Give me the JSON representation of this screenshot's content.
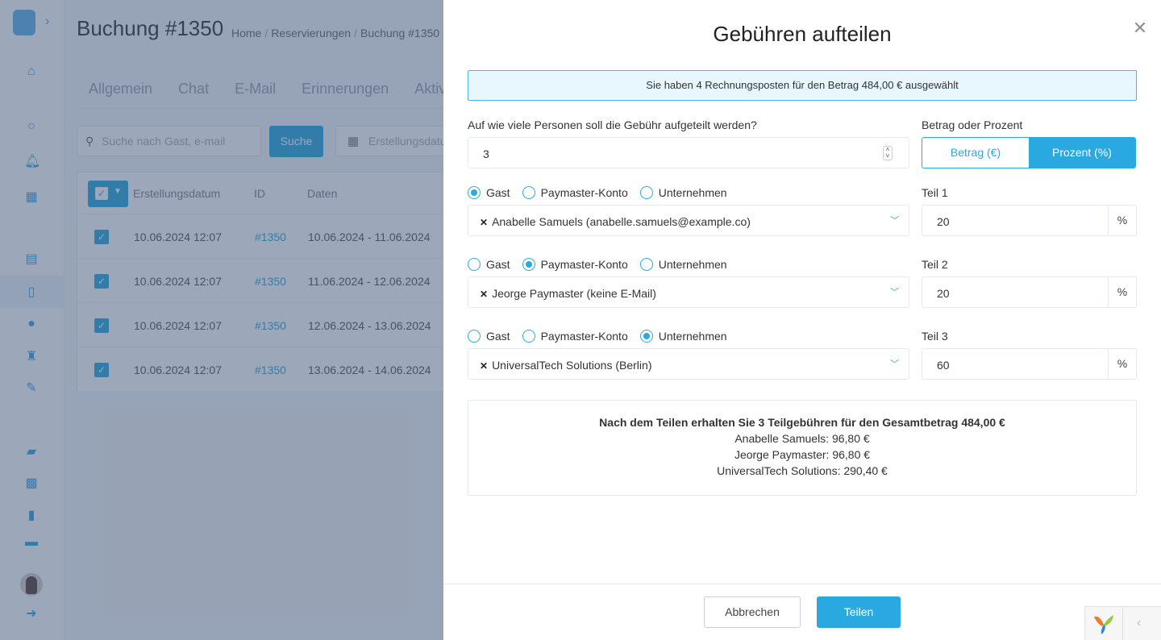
{
  "app": {
    "page_title": "Buchung #1350",
    "breadcrumb": [
      "Home",
      "Reservierungen",
      "Buchung #1350"
    ],
    "tabs": [
      "Allgemein",
      "Chat",
      "E-Mail",
      "Erinnerungen",
      "Aktiv"
    ],
    "search": {
      "placeholder": "Suche nach Gast, e-mail",
      "button": "Suche"
    },
    "date_filter": {
      "placeholder": "Erstellungsdatum"
    },
    "table": {
      "columns": [
        "Erstellungsdatum",
        "ID",
        "Daten"
      ],
      "rows": [
        {
          "created": "10.06.2024 12:07",
          "id": "#1350",
          "dates": "10.06.2024 - 11.06.2024",
          "checked": true
        },
        {
          "created": "10.06.2024 12:07",
          "id": "#1350",
          "dates": "11.06.2024 - 12.06.2024",
          "checked": true
        },
        {
          "created": "10.06.2024 12:07",
          "id": "#1350",
          "dates": "12.06.2024 - 13.06.2024",
          "checked": true
        },
        {
          "created": "10.06.2024 12:07",
          "id": "#1350",
          "dates": "13.06.2024 - 14.06.2024",
          "checked": true
        }
      ]
    },
    "sidebar_icons": [
      "logo-icon",
      "home-icon",
      "search-icon",
      "bell-icon",
      "dashboard-icon",
      "calendar-icon",
      "document-icon",
      "user-icon",
      "cleaning-icon",
      "wrench-icon",
      "folder-icon",
      "widgets-icon",
      "book-icon",
      "inbox-icon",
      "avatar",
      "logout-icon"
    ]
  },
  "modal": {
    "title": "Gebühren aufteilen",
    "info": "Sie haben 4 Rechnungsposten für den Betrag 484,00 € ausgewählt",
    "persons_label": "Auf wie viele Personen soll die Gebühr aufgeteilt werden?",
    "persons_value": "3",
    "mode_label": "Betrag oder Prozent",
    "mode_options": [
      {
        "label": "Betrag (€)",
        "active": false
      },
      {
        "label": "Prozent (%)",
        "active": true
      }
    ],
    "radio_options": [
      "Gast",
      "Paymaster-Konto",
      "Unternehmen"
    ],
    "parts": [
      {
        "label": "Teil 1",
        "type": "Gast",
        "selection": "Anabelle Samuels (anabelle.samuels@example.co)",
        "value": "20",
        "unit": "%"
      },
      {
        "label": "Teil 2",
        "type": "Paymaster-Konto",
        "selection": "Jeorge Paymaster (keine E-Mail)",
        "value": "20",
        "unit": "%"
      },
      {
        "label": "Teil 3",
        "type": "Unternehmen",
        "selection": "UniversalTech Solutions (Berlin)",
        "value": "60",
        "unit": "%"
      }
    ],
    "summary": {
      "head": "Nach dem Teilen erhalten Sie 3 Teilgebühren für den Gesamtbetrag 484,00 €",
      "lines": [
        "Anabelle Samuels: 96,80 €",
        "Jeorge Paymaster: 96,80 €",
        "UniversalTech Solutions: 290,40 €"
      ]
    },
    "cancel": "Abbrechen",
    "submit": "Teilen"
  },
  "colors": {
    "accent": "#2aa9e0",
    "info_bg": "#e8f6fd",
    "overlay": "#39507380"
  }
}
